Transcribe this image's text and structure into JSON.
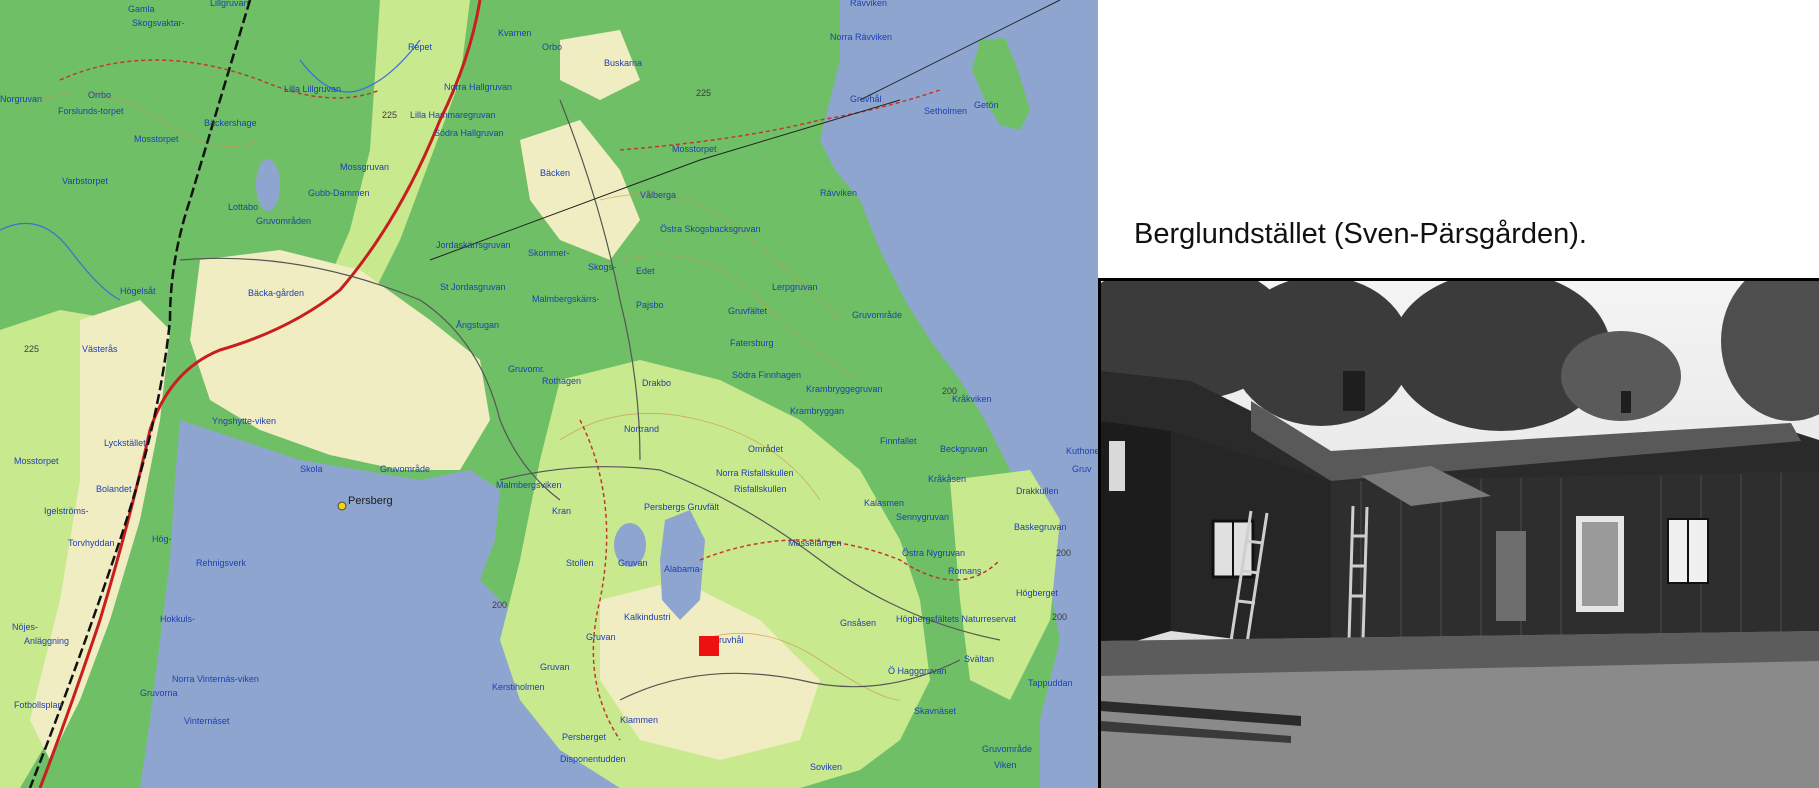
{
  "map": {
    "marker_color": "#ee1111",
    "colors": {
      "water": "#8ea6cf",
      "forest": "#6fbf67",
      "open": "#f1edc3",
      "light_green": "#c9e98e",
      "railway": "#111111",
      "main_road": "#c81e1e",
      "trail": "#c0392b",
      "label": "#1d3fb3"
    },
    "icons": {
      "marker": "red-square-marker",
      "place_dot": "yellow-dot"
    },
    "labels": [
      "Gamla",
      "Lillgruvan",
      "Skogsvaktar-",
      "Kvarnen",
      "Orbo",
      "Buskarna",
      "Rävviken",
      "Norra Rävviken",
      "Repet",
      "Norra Hallgruvan",
      "Lilla Lillgruvan",
      "Bäckershage",
      "Forslunds-torpet",
      "Orrbo",
      "Norgruvan",
      "Mosstorpet",
      "Varbstorpet",
      "Lottabo",
      "Gruvområden",
      "Lilla Hammaregruvan",
      "Södra Hallgruvan",
      "Mossgruvan",
      "Gubb-Dammen",
      "Bäcken",
      "Mosstorpet",
      "Gruvhål",
      "Setholmen",
      "Getön",
      "Rävviken",
      "Vålberga",
      "Östra Skogsbacksgruvan",
      "Jordaskärrsgruvan",
      "Skommer-",
      "Skogs-",
      "Edet",
      "Högelsåt",
      "Bäcka-gården",
      "St Jordasgruvan",
      "Malmbergskärrs-",
      "Pajsbo",
      "Lerpgruvan",
      "Gruvområde",
      "Gruvfältet",
      "Ångstugan",
      "Västerås",
      "Fatersburg",
      "Gruvomr.",
      "Rothagen",
      "Drakbo",
      "Södra Finnhagen",
      "Krambryggegruvan",
      "Krambryggan",
      "Kråkviken",
      "Yngshytte-viken",
      "Lyckstället",
      "Nortrand",
      "Området",
      "Finnfallet",
      "Beckgruvan",
      "Mosstorpet",
      "Skola",
      "Gruvområde",
      "Malmbergsviken",
      "Norra Risfallskullen",
      "Risfallskullen",
      "Persberg",
      "Kran",
      "Persbergs Gruvfält",
      "Kalasmen",
      "Sennygruvan",
      "Kråkåsen",
      "Drakkullen",
      "Baskegruvan",
      "Bolandet",
      "Igelströms-",
      "Torvhyddan",
      "Hög-",
      "Rehnigsverk",
      "Stollen",
      "Gruvan",
      "Alabama-",
      "Masselången",
      "Östra Nygruvan",
      "Romans",
      "Högberget",
      "Nöjes-",
      "Anläggning",
      "Hokkuls-",
      "Kalkindustri",
      "Gruvan",
      "Gruvhål",
      "Gruvan",
      "Gnsåsen",
      "Högbergsfältets Naturreservat",
      "Svältan",
      "Norra Vinternäs-viken",
      "Gruvorna",
      "Ö Hagggruvan",
      "Tappuddan",
      "Fotbollsplan",
      "Vinternäset",
      "Kerstiholmen",
      "Klammen",
      "Skavnäset",
      "Gruvområde",
      "Persberget",
      "Disponentudden",
      "Soviken",
      "Viken",
      "Kuthonen",
      "Gruv"
    ],
    "contour_labels": [
      "225",
      "225",
      "225",
      "200",
      "200",
      "200",
      "200"
    ]
  },
  "photo": {
    "caption": "Berglundstället (Sven-Pärsgården)."
  }
}
